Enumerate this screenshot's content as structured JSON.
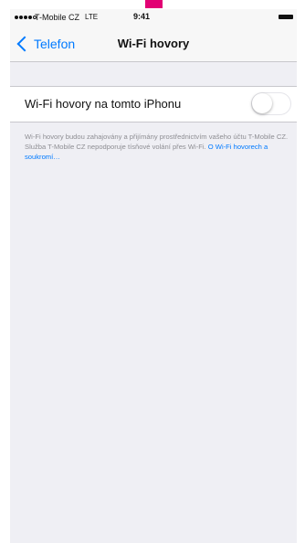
{
  "status_bar": {
    "carrier": "T-Mobile CZ",
    "network": "LTE",
    "time": "9:41",
    "signal_bars_filled": 4,
    "signal_bars_total": 5
  },
  "nav": {
    "back_label": "Telefon",
    "title": "Wi-Fi hovory"
  },
  "setting": {
    "label": "Wi-Fi hovory na tomto iPhonu",
    "enabled": false
  },
  "footer": {
    "text": "Wi-Fi hovory budou zahajovány a přijímány prostřednictvím vašeho účtu T-Mobile CZ. Služba T-Mobile CZ nepodporuje tísňové volání přes Wi-Fi. ",
    "link": "O Wi-Fi hovorech a soukromí…"
  },
  "colors": {
    "accent": "#007aff",
    "brand": "#e20074",
    "background": "#efeff4",
    "footer_text": "#8e8e93"
  },
  "icons": {
    "back": "chevron-left-icon",
    "battery": "battery-icon",
    "signal": "signal-dots-icon"
  }
}
